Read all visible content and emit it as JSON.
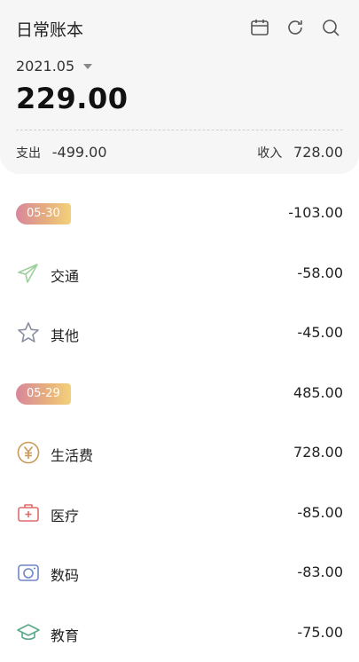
{
  "app": {
    "title": "日常账本"
  },
  "header": {
    "month": "2021.05",
    "balance": "229.00",
    "expense_label": "支出",
    "expense_value": "-499.00",
    "income_label": "收入",
    "income_value": "728.00"
  },
  "icons": {
    "calendar": "calendar-icon",
    "refresh": "refresh-icon",
    "search": "search-icon"
  },
  "groups": [
    {
      "date": "05-30",
      "total": "-103.00",
      "items": [
        {
          "icon": "paper-plane-icon",
          "label": "交通",
          "amount": "-58.00",
          "color": "#9ccf9a"
        },
        {
          "icon": "star-icon",
          "label": "其他",
          "amount": "-45.00",
          "color": "#8a8fa0"
        }
      ]
    },
    {
      "date": "05-29",
      "total": "485.00",
      "items": [
        {
          "icon": "yen-icon",
          "label": "生活费",
          "amount": "728.00",
          "color": "#c99a57"
        },
        {
          "icon": "medical-kit-icon",
          "label": "医疗",
          "amount": "-85.00",
          "color": "#e06b6b"
        },
        {
          "icon": "camera-icon",
          "label": "数码",
          "amount": "-83.00",
          "color": "#6f86c9"
        },
        {
          "icon": "graduation-cap-icon",
          "label": "教育",
          "amount": "-75.00",
          "color": "#5aaa8a"
        }
      ]
    }
  ]
}
